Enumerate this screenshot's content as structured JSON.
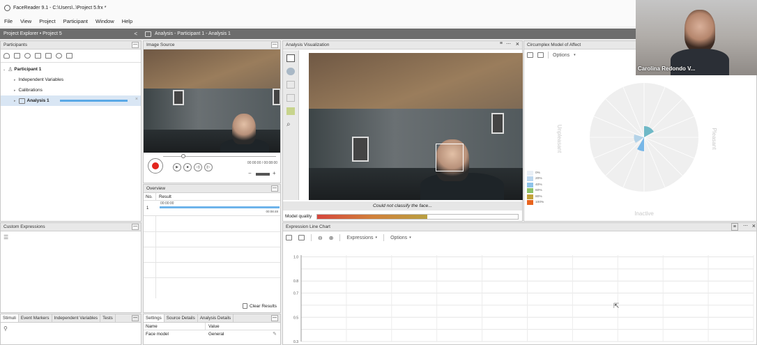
{
  "window": {
    "title": "FaceReader 9.1 - C:\\Users\\..\\Project 5.frx *"
  },
  "menu": [
    "File",
    "View",
    "Project",
    "Participant",
    "Window",
    "Help"
  ],
  "project_explorer": {
    "title": "Project Explorer • Project 5",
    "collapse_glyph": "<"
  },
  "analysis_header": {
    "title": "Analysis - Participant 1 - Analysis 1"
  },
  "participants": {
    "title": "Participants",
    "tree": {
      "participant": "Participant 1",
      "independent_variables": "Independent Variables",
      "calibrations": "Calibrations",
      "analysis": "Analysis 1"
    }
  },
  "custom_expressions": {
    "title": "Custom Expressions"
  },
  "bottom_tabs": [
    "Stimuli",
    "Event Markers",
    "Independent Variables",
    "Tests"
  ],
  "image_source": {
    "title": "Image Source",
    "time_readout": "00:00:00 / 00:08:00",
    "minus": "−",
    "plus": "+"
  },
  "overview": {
    "title": "Overview",
    "columns": [
      "No.",
      "Result"
    ],
    "row": {
      "no": "1",
      "start": "00:00:00",
      "end": "00:08:48"
    },
    "clear_label": "Clear Results"
  },
  "settings": {
    "tabs": [
      "Settings",
      "Source Details",
      "Analysis Details"
    ],
    "columns": [
      "Name",
      "Value"
    ],
    "row": {
      "name": "Face model",
      "value": "General"
    }
  },
  "analysis_visualization": {
    "title": "Analysis Visualization",
    "status": "Could not classify the face...",
    "model_quality_label": "Model quality",
    "model_quality_fill": 0.55
  },
  "circumplex": {
    "title": "Circumplex Model of Affect",
    "options_label": "Options",
    "left_label": "Unpleasant",
    "right_label": "Pleasant",
    "bottom_label": "Inactive",
    "legend": [
      {
        "label": "0%",
        "color": "#e9eff6"
      },
      {
        "label": "20%",
        "color": "#bcd7ef"
      },
      {
        "label": "40%",
        "color": "#8ec3ea"
      },
      {
        "label": "60%",
        "color": "#8dc26a"
      },
      {
        "label": "80%",
        "color": "#c2a23a"
      },
      {
        "label": "100%",
        "color": "#e8641e"
      }
    ]
  },
  "expression_chart": {
    "title": "Expression Line Chart",
    "expressions_label": "Expressions",
    "options_label": "Options"
  },
  "video_call": {
    "name": "Carolina Redondo V..."
  },
  "chart_data": {
    "type": "line",
    "title": "",
    "xlabel": "",
    "ylabel": "",
    "y_ticks": [
      "1.0",
      "0.9",
      "0.8",
      "0.7",
      "0.6",
      "0.5",
      "0.4",
      "0.3"
    ],
    "y_tick_labels_shown": [
      "1.0",
      "0.8",
      "0.7",
      "0.5",
      "0.3"
    ],
    "ylim": [
      0.3,
      1.0
    ],
    "grid": true,
    "series": []
  }
}
